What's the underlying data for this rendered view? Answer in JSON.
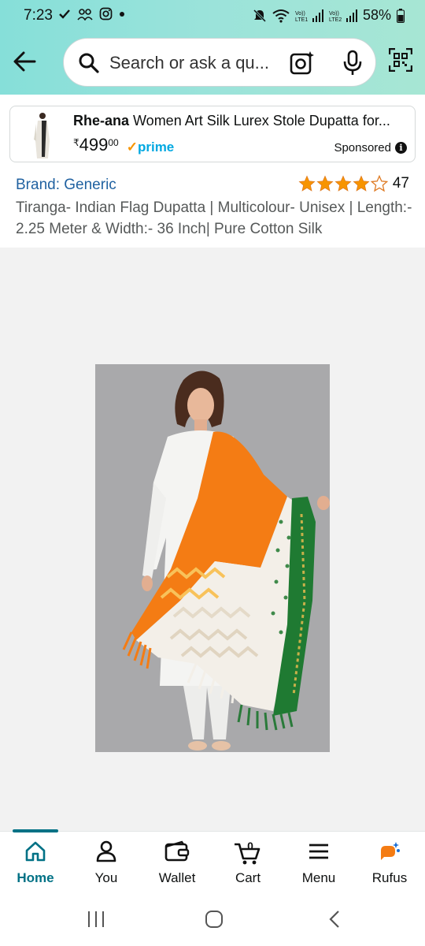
{
  "status_bar": {
    "time": "7:23",
    "battery": "58%"
  },
  "search": {
    "placeholder": "Search or ask a qu..."
  },
  "sponsored_ad": {
    "brand": "Rhe-ana",
    "title": " Women Art Silk Lurex Stole Dupatta for...",
    "currency": "₹",
    "price_whole": "499",
    "price_fraction": "00",
    "prime_label": "prime",
    "sponsored_label": "Sponsored"
  },
  "product": {
    "brand": "Brand: Generic",
    "rating": 4.5,
    "rating_count": "47",
    "title": "Tiranga- Indian Flag Dupatta | Multicolour- Unisex | Length:- 2.25 Meter & Width:- 36 Inch| Pure Cotton Silk"
  },
  "bottom_nav": {
    "items": [
      {
        "label": "Home",
        "icon": "home-icon",
        "active": true
      },
      {
        "label": "You",
        "icon": "person-icon",
        "active": false
      },
      {
        "label": "Wallet",
        "icon": "wallet-icon",
        "active": false
      },
      {
        "label": "Cart",
        "icon": "cart-icon",
        "active": false,
        "count": "0"
      },
      {
        "label": "Menu",
        "icon": "menu-icon",
        "active": false
      },
      {
        "label": "Rufus",
        "icon": "rufus-icon",
        "active": false
      }
    ]
  },
  "colors": {
    "header_teal": "#9be3da",
    "link_blue": "#2162a1",
    "active_teal": "#007185",
    "star_orange": "#f79400",
    "prime_blue": "#00a8e1"
  }
}
